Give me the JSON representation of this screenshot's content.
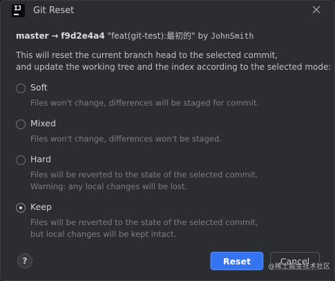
{
  "window": {
    "title": "Git Reset",
    "app_icon": "intellij-icon",
    "app_icon_text": "IJ"
  },
  "commit": {
    "branch": "master",
    "arrow": "→",
    "hash": "f9d2e4a4",
    "message": "\"feat(git-test):最初的\"",
    "by": "by",
    "author": "JohnSmith"
  },
  "description": {
    "line1": "This will reset the current branch head to the selected commit,",
    "line2": "and update the working tree and the index according to the selected mode:"
  },
  "options": [
    {
      "label": "Soft",
      "desc1": "Files won't change, differences will be staged for commit.",
      "desc2": "",
      "checked": false
    },
    {
      "label": "Mixed",
      "desc1": "Files won't change, differences won't be staged.",
      "desc2": "",
      "checked": false
    },
    {
      "label": "Hard",
      "desc1": "Files will be reverted to the state of the selected commit.",
      "desc2": "Warning: any local changes will be lost.",
      "checked": false
    },
    {
      "label": "Keep",
      "desc1": "Files will be reverted to the state of the selected commit,",
      "desc2": "but local changes will be kept intact.",
      "checked": true
    }
  ],
  "footer": {
    "help_label": "?",
    "reset_label": "Reset",
    "cancel_label": "Cancel"
  },
  "watermark": "@稀土掘金技术社区",
  "colors": {
    "dialog_bg": "#2b2d30",
    "primary_button": "#3574f0",
    "text": "#bdbfc4",
    "muted_text": "#7b7e85"
  }
}
